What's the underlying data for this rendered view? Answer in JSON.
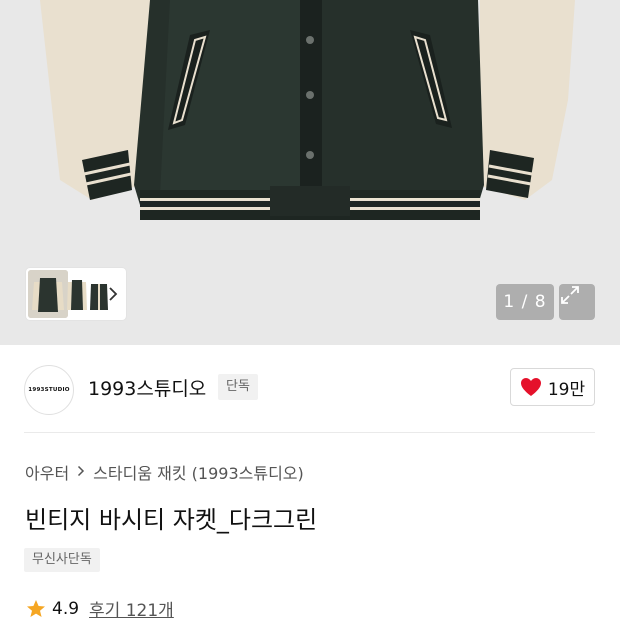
{
  "gallery": {
    "counter": "1 / 8",
    "expand_icon": "expand-icon",
    "next_icon": "chevron-right-icon"
  },
  "brand": {
    "logo_text": "1993STUDIO",
    "name": "1993스튜디오",
    "badge": "단독",
    "likes": "19만",
    "like_icon": "heart-icon",
    "like_color": "#e5112b"
  },
  "product": {
    "breadcrumb": [
      "아우터",
      "스타디움 재킷 (1993스튜디오)"
    ],
    "title": "빈티지 바시티 자켓_다크그린",
    "tag": "무신사단독",
    "rating": "4.9",
    "reviews": "후기 121개",
    "star_color": "#f5a623"
  }
}
